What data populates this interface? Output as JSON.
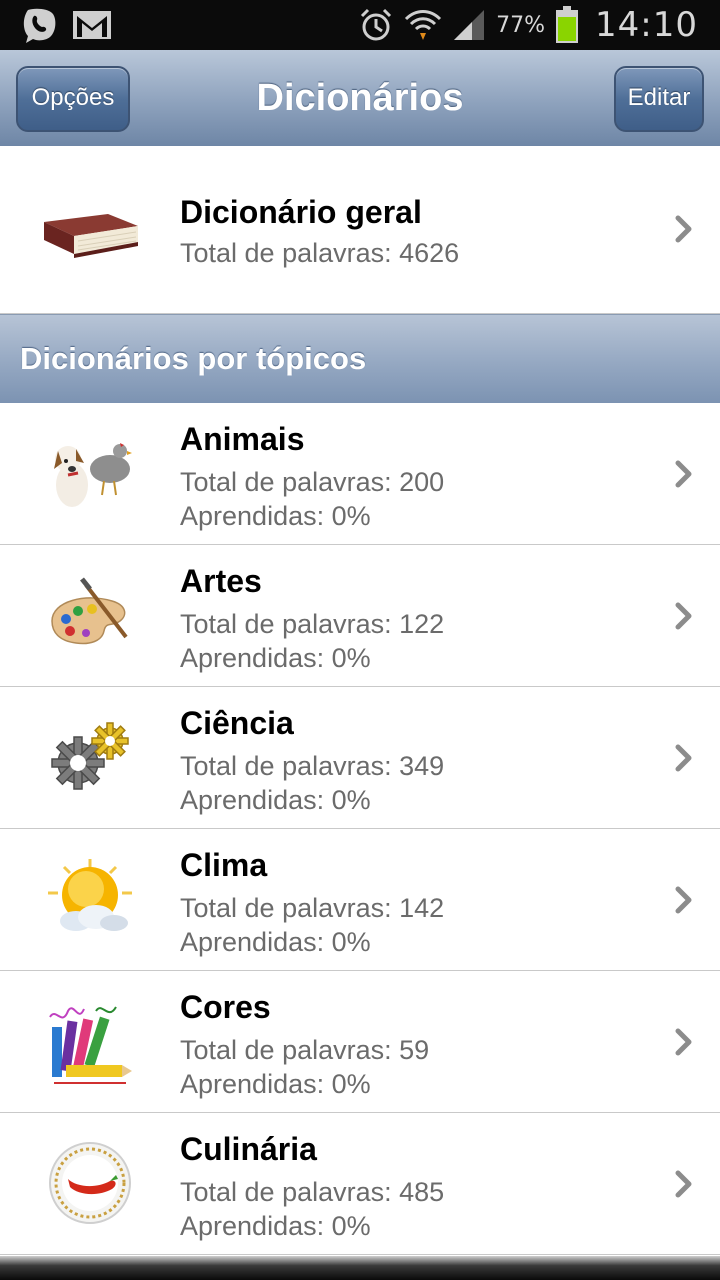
{
  "status": {
    "battery": "77%",
    "time": "14:10"
  },
  "nav": {
    "title": "Dicionários",
    "left_button": "Opções",
    "right_button": "Editar"
  },
  "general": {
    "title": "Dicionário geral",
    "total": "Total de palavras: 4626",
    "icon": "book-icon"
  },
  "section": {
    "label": "Dicionários por tópicos"
  },
  "topics": [
    {
      "title": "Animais",
      "total": "Total de palavras: 200",
      "learned": "Aprendidas: 0%",
      "icon": "animals-icon"
    },
    {
      "title": "Artes",
      "total": "Total de palavras: 122",
      "learned": "Aprendidas: 0%",
      "icon": "palette-icon"
    },
    {
      "title": "Ciência",
      "total": "Total de palavras: 349",
      "learned": "Aprendidas: 0%",
      "icon": "gears-icon"
    },
    {
      "title": "Clima",
      "total": "Total de palavras: 142",
      "learned": "Aprendidas: 0%",
      "icon": "weather-icon"
    },
    {
      "title": "Cores",
      "total": "Total de palavras: 59",
      "learned": "Aprendidas: 0%",
      "icon": "pencils-icon"
    },
    {
      "title": "Culinária",
      "total": "Total de palavras: 485",
      "learned": "Aprendidas: 0%",
      "icon": "plate-icon"
    }
  ],
  "colors": {
    "nav_top": "#b9c7d9",
    "nav_bottom": "#6e86a6",
    "subtitle": "#6b6b6b",
    "battery": "#8ad400"
  }
}
